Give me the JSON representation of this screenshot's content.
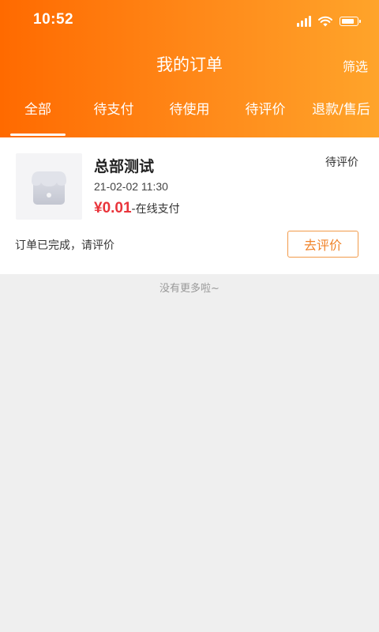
{
  "status_bar": {
    "time": "10:52"
  },
  "header": {
    "title": "我的订单",
    "filter_label": "筛选"
  },
  "tabs": [
    {
      "label": "全部",
      "active": true
    },
    {
      "label": "待支付",
      "active": false
    },
    {
      "label": "待使用",
      "active": false
    },
    {
      "label": "待评价",
      "active": false
    },
    {
      "label": "退款/售后",
      "active": false
    }
  ],
  "orders": [
    {
      "shop_name": "总部测试",
      "status": "待评价",
      "date": "21-02-02 11:30",
      "price": "¥0.01",
      "pay_method": "-在线支付",
      "note": "订单已完成，请评价",
      "action_label": "去评价"
    }
  ],
  "footer": {
    "no_more": "没有更多啦~"
  },
  "colors": {
    "accent": "#ff7a0f",
    "price": "#e9343b",
    "button_border": "#f29a4a"
  },
  "icons": [
    "signal-icon",
    "wifi-icon",
    "battery-icon",
    "shop-placeholder-icon"
  ]
}
